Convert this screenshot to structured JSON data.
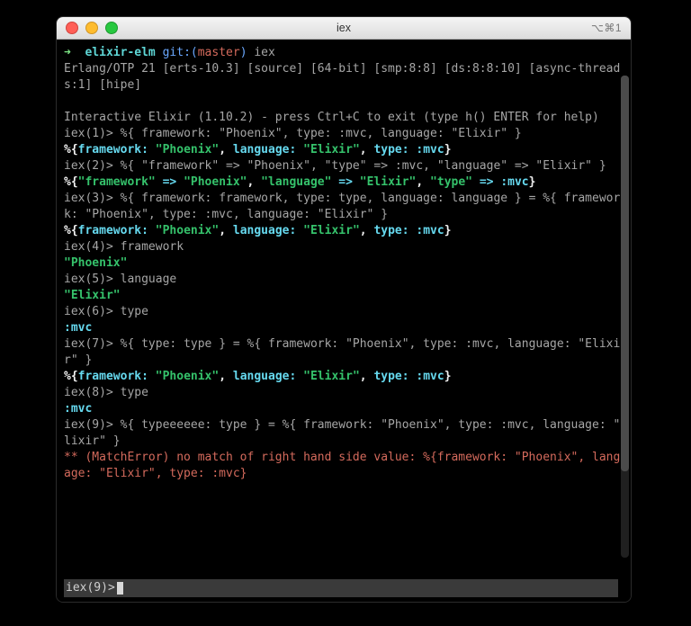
{
  "window": {
    "title": "iex",
    "right_indicator": "⌥⌘1"
  },
  "ps1": {
    "arrow": "➜",
    "dir": "elixir-elm",
    "git_pre": " git:(",
    "branch": "master",
    "git_post": ")",
    "cmd": " iex"
  },
  "banner": {
    "erl": "Erlang/OTP 21 [erts-10.3] [source] [64-bit] [smp:8:8] [ds:8:8:10] [async-threads:1] [hipe]",
    "iex": "Interactive Elixir (1.10.2) - press Ctrl+C to exit (type h() ENTER for help)"
  },
  "lines": {
    "l1_prompt": "iex(1)> ",
    "l1_in": "%{ framework: \"Phoenix\", type: :mvc, language: \"Elixir\" }",
    "out1_open": "%{",
    "out1_k1": "framework:",
    "out1_v1": " \"Phoenix\"",
    "out1_sep": ", ",
    "out1_k2": "language:",
    "out1_v2": " \"Elixir\"",
    "out1_k3": "type:",
    "out1_v3": " :mvc",
    "out1_close": "}",
    "l2_prompt": "iex(2)> ",
    "l2_in": "%{ \"framework\" => \"Phoenix\", \"type\" => :mvc, \"language\" => \"Elixir\" }",
    "out2_open": "%{",
    "out2_k1": "\"framework\"",
    "out2_arrow": " => ",
    "out2_v1": "\"Phoenix\"",
    "out2_k2": "\"language\"",
    "out2_v2": "\"Elixir\"",
    "out2_k3": "\"type\"",
    "out2_v3": ":mvc",
    "out2_close": "}",
    "l3_prompt": "iex(3)> ",
    "l3_in": "%{ framework: framework, type: type, language: language } = %{ framework: \"Phoenix\", type: :mvc, language: \"Elixir\" }",
    "l4_prompt": "iex(4)> ",
    "l4_in": "framework",
    "l4_out": "\"Phoenix\"",
    "l5_prompt": "iex(5)> ",
    "l5_in": "language",
    "l5_out": "\"Elixir\"",
    "l6_prompt": "iex(6)> ",
    "l6_in": "type",
    "l6_out": ":mvc",
    "l7_prompt": "iex(7)> ",
    "l7_in": "%{ type: type } = %{ framework: \"Phoenix\", type: :mvc, language: \"Elixir\" }",
    "l8_prompt": "iex(8)> ",
    "l8_in": "type",
    "l8_out": ":mvc",
    "l9_prompt": "iex(9)> ",
    "l9_in": "%{ typeeeeee: type } = %{ framework: \"Phoenix\", type: :mvc, language: \"Elixir\" }",
    "l9_err": "** (MatchError) no match of right hand side value: %{framework: \"Phoenix\", language: \"Elixir\", type: :mvc}",
    "footer_prompt": "iex(9)> "
  }
}
